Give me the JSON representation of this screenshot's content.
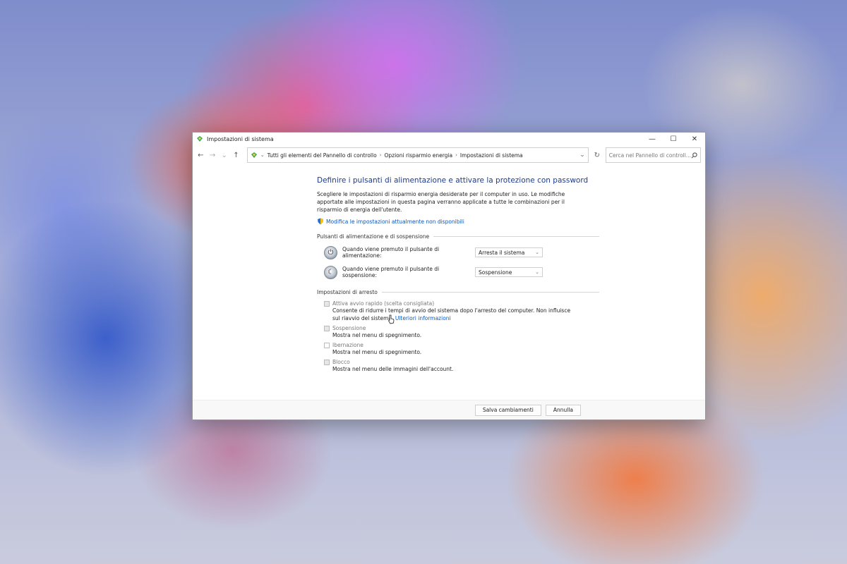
{
  "window": {
    "title": "Impostazioni di sistema",
    "controls": {
      "minimize": "—",
      "maximize": "☐",
      "close": "✕"
    }
  },
  "navigation": {
    "back": "←",
    "forward": "→",
    "recent": "⌄",
    "up": "↑",
    "breadcrumbs": [
      "Tutti gli elementi del Pannello di controllo",
      "Opzioni risparmio energia",
      "Impostazioni di sistema"
    ],
    "refresh": "↻",
    "search_placeholder": "Cerca nel Pannello di controll..."
  },
  "content": {
    "heading": "Definire i pulsanti di alimentazione e attivare la protezione con password",
    "description": "Scegliere le impostazioni di risparmio energia desiderate per il computer in uso. Le modifiche apportate alle impostazioni in questa pagina verranno applicate a tutte le combinazioni per il risparmio di energia dell'utente.",
    "admin_link": "Modifica le impostazioni attualmente non disponibili",
    "power_section": {
      "title": "Pulsanti di alimentazione e di sospensione",
      "power_button_label": "Quando viene premuto il pulsante di alimentazione:",
      "power_button_value": "Arresta il sistema",
      "sleep_button_label": "Quando viene premuto il pulsante di sospensione:",
      "sleep_button_value": "Sospensione"
    },
    "shutdown_section": {
      "title": "Impostazioni di arresto",
      "items": [
        {
          "label": "Attiva avvio rapido (scelta consigliata)",
          "description": "Consente di ridurre i tempi di avvio del sistema dopo l'arresto del computer. Non influisce sul riavvio del sistema.",
          "link": "Ulteriori informazioni"
        },
        {
          "label": "Sospensione",
          "description": "Mostra nel menu di spegnimento."
        },
        {
          "label": "Ibernazione",
          "description": "Mostra nel menu di spegnimento."
        },
        {
          "label": "Blocco",
          "description": "Mostra nel menu delle immagini dell'account."
        }
      ]
    }
  },
  "footer": {
    "save": "Salva cambiamenti",
    "cancel": "Annulla"
  },
  "colors": {
    "heading": "#1c3b8f",
    "link": "#0a57c2"
  }
}
